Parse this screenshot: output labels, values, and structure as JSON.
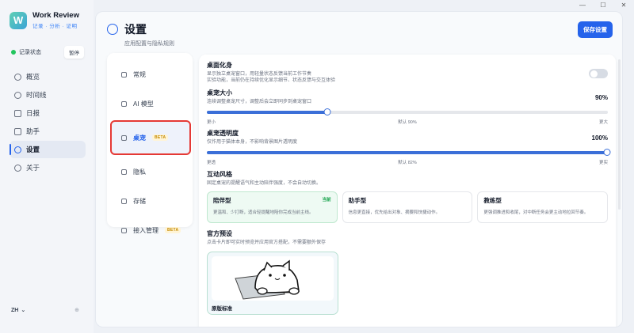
{
  "window": {
    "minimize": "—",
    "maximize": "☐",
    "close": "✕"
  },
  "app": {
    "logo_letter": "W",
    "name": "Work Review",
    "tagline": "记录 · 分析 · 证明"
  },
  "record": {
    "label": "记录状态",
    "pause": "暂停"
  },
  "nav": [
    {
      "label": "概览"
    },
    {
      "label": "时间线"
    },
    {
      "label": "日报"
    },
    {
      "label": "助手"
    },
    {
      "label": "设置"
    },
    {
      "label": "关于"
    }
  ],
  "lang": {
    "code": "ZH",
    "arrow": "⌄",
    "extra": "⊕"
  },
  "header": {
    "title": "设置",
    "subtitle": "应用配置与隐私规则",
    "save": "保存设置"
  },
  "menu": [
    {
      "label": "常规"
    },
    {
      "label": "AI 模型"
    },
    {
      "label": "桌宠",
      "badge": "BETA"
    },
    {
      "label": "隐私"
    },
    {
      "label": "存储"
    },
    {
      "label": "接入管理",
      "badge": "BETA"
    }
  ],
  "settings": {
    "desktop": {
      "title": "桌面化身",
      "desc": "显示独立桌宠窗口，用轻量状态反馈当前工作节奏",
      "desc2": "实验功能，当前仍在持续优化显示细节、状态反馈与交互体验",
      "enabled": false
    },
    "size": {
      "title": "桌宠大小",
      "desc": "连续调整桌宠尺寸，调整后会立即同步到桌宠窗口",
      "value_label": "90%",
      "value": 0.3,
      "min": "更小",
      "default": "默认 90%",
      "max": "更大"
    },
    "opacity": {
      "title": "桌宠透明度",
      "desc": "仅作用于猫体本身，不影响背景图片透明度",
      "value_label": "100%",
      "value": 1.0,
      "min": "更透",
      "default": "默认 82%",
      "max": "更实"
    },
    "style": {
      "title": "互动风格",
      "desc": "固定桌宠的提醒语气和主动陪伴强度，不会自动切换。",
      "options": [
        {
          "name": "陪伴型",
          "current": "当前",
          "desc": "更温和、少打断，适合轻提醒地陪你完成当前主线。"
        },
        {
          "name": "助手型",
          "desc": "信息更直接，优先给出对象、摘要和快捷动作。"
        },
        {
          "name": "教练型",
          "desc": "更强调推进和收尾，对中断任务会更主动地拉回节奏。"
        }
      ]
    },
    "preset": {
      "title": "官方预设",
      "desc": "点击卡片即可实时预览并应用官方搭配，不需要额外保存",
      "card_label": "原版标准"
    }
  },
  "colors": {
    "accent": "#2563eb",
    "green": "#22c55e",
    "highlight": "#e53935"
  }
}
